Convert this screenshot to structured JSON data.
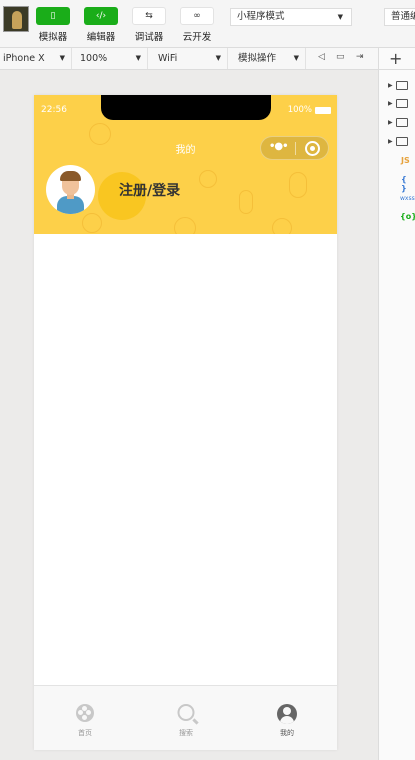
{
  "toolbar": {
    "buttons": [
      {
        "label": "模拟器",
        "icon": "phone-icon"
      },
      {
        "label": "编辑器",
        "icon": "code-icon"
      },
      {
        "label": "调试器",
        "icon": "debug-icon"
      },
      {
        "label": "云开发",
        "icon": "cloud-icon"
      }
    ],
    "mode": "小程序模式",
    "compile": "普通编"
  },
  "devicebar": {
    "device": "iPhone X",
    "zoom": "100%",
    "network": "WiFi",
    "operation": "模拟操作"
  },
  "simulator": {
    "time": "22:56",
    "battery": "100%",
    "nav_title": "我的",
    "login_text": "注册/登录",
    "accent_color": "#fdd049"
  },
  "tabbar": {
    "items": [
      {
        "label": "首页",
        "icon": "film-icon"
      },
      {
        "label": "搜索",
        "icon": "search-icon"
      },
      {
        "label": "我的",
        "icon": "user-icon"
      }
    ]
  },
  "filetree": {
    "items": [
      "JS",
      "{ }",
      "wxss",
      "{o}"
    ]
  }
}
